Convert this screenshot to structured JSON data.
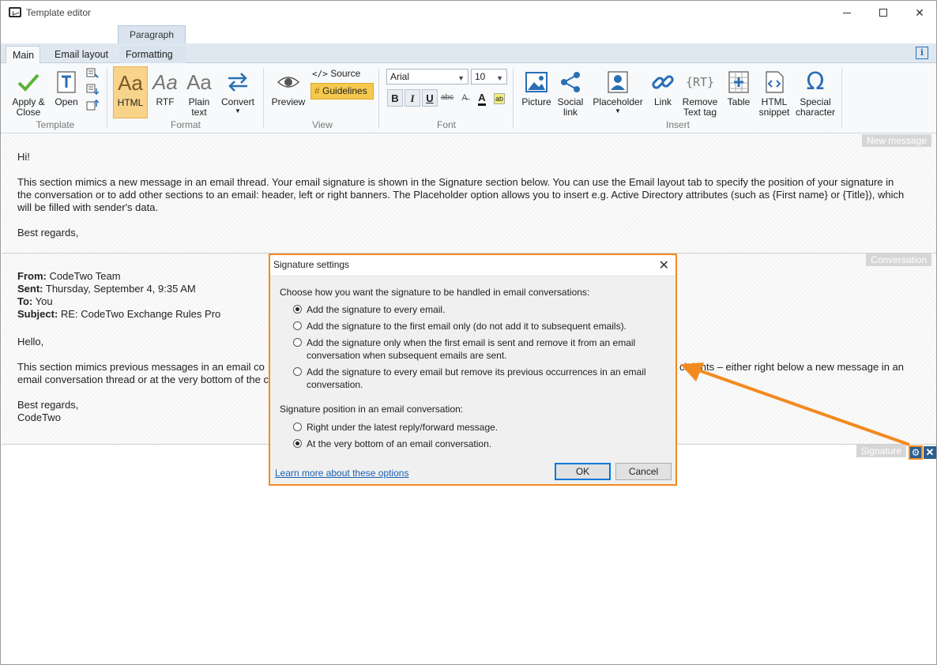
{
  "window": {
    "title": "Template editor"
  },
  "ribbon": {
    "context_tab": "Paragraph",
    "tabs": [
      "Main",
      "Email layout",
      "Formatting"
    ],
    "info": "i",
    "groups": {
      "template": {
        "label": "Template",
        "apply_close": "Apply &\nClose",
        "open": "Open"
      },
      "format": {
        "label": "Format",
        "html": "HTML",
        "rtf": "RTF",
        "plain_text": "Plain\ntext",
        "convert": "Convert",
        "aa_glyph": "Aa"
      },
      "view": {
        "label": "View",
        "preview": "Preview",
        "source": "Source",
        "guidelines": "Guidelines"
      },
      "font": {
        "label": "Font",
        "font_name": "Arial",
        "font_size": "10",
        "bold": "B",
        "italic": "I",
        "underline": "U",
        "strike": "abc",
        "font_color": "A"
      },
      "insert": {
        "label": "Insert",
        "picture": "Picture",
        "social_link": "Social\nlink",
        "placeholder": "Placeholder",
        "link": "Link",
        "remove_text_tag": "Remove\nText tag",
        "table": "Table",
        "html_snippet": "HTML\nsnippet",
        "special_character": "Special\ncharacter",
        "rt_glyph": "RT",
        "omega_glyph": "Ω"
      }
    }
  },
  "sections": {
    "new_message": {
      "tag": "New message",
      "greeting": "Hi!",
      "body": "This section mimics a new message in an email thread. Your email signature is shown in the Signature section below. You can use the Email layout tab to specify the position of your signature in the conversation or to add other sections to an email: header, left or right banners. The Placeholder option allows you to insert e.g. Active Directory attributes (such as {First name} or {Title}), which will be filled with sender's data.",
      "closing": "Best regards,"
    },
    "conversation": {
      "tag": "Conversation",
      "from_label": "From:",
      "from_value": "CodeTwo Team",
      "sent_label": "Sent:",
      "sent_value": "Thursday, September 4, 9:35 AM",
      "to_label": "To:",
      "to_value": "You",
      "subject_label": "Subject:",
      "subject_value": "RE: CodeTwo Exchange Rules Pro",
      "greeting": "Hello,",
      "body_line1": "This section mimics previous messages in an email co",
      "body_line1_tail": "cipients – either right below a new message in an",
      "body_line2": "email conversation thread or at the very bottom of the c",
      "closing": "Best regards,",
      "signature": "CodeTwo"
    },
    "signature": {
      "tag": "Signature"
    }
  },
  "dialog": {
    "title": "Signature settings",
    "prompt": "Choose how you want the signature to be handled in email conversations:",
    "handling_options": [
      {
        "label": "Add the signature to every email.",
        "checked": true
      },
      {
        "label": "Add the signature to the first email only (do not add it to subsequent emails).",
        "checked": false
      },
      {
        "label": "Add the signature only when the first email is sent and remove it from an email conversation when subsequent emails are sent.",
        "checked": false
      },
      {
        "label": "Add the signature to every email but remove its previous occurrences in an email conversation.",
        "checked": false
      }
    ],
    "position_label": "Signature position in an email conversation:",
    "position_options": [
      {
        "label": "Right under the latest reply/forward message.",
        "checked": false
      },
      {
        "label": "At the very bottom of an email conversation.",
        "checked": true
      }
    ],
    "learn_more": "Learn more about these options",
    "ok": "OK",
    "cancel": "Cancel"
  },
  "colors": {
    "accent_orange": "#f38a1f",
    "ribbon_blue": "#2a6fb5",
    "html_active": "#f8d38a",
    "guidelines": "#f6c94e"
  }
}
